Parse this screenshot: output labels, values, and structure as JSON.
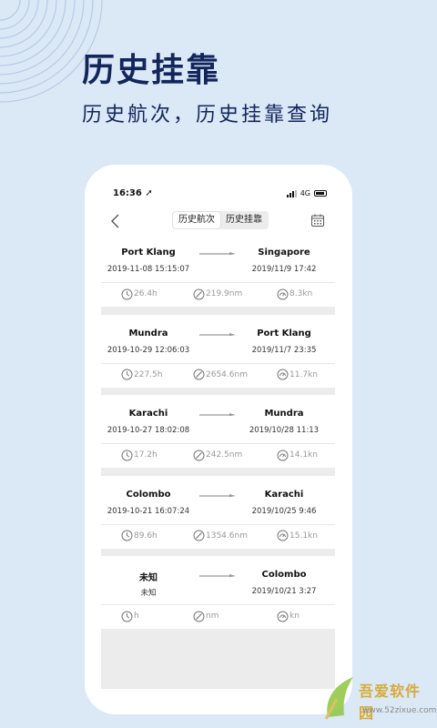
{
  "hero": {
    "title": "历史挂靠",
    "subtitle": "历史航次，历史挂靠查询"
  },
  "status_bar": {
    "time": "16:36 ➚",
    "network": "4G"
  },
  "tabs": [
    {
      "label": "历史航次",
      "active": true
    },
    {
      "label": "历史挂靠",
      "active": false
    }
  ],
  "voyages": [
    {
      "from_port": "Port Klang",
      "from_time": "2019-11-08 15:15:07",
      "to_port": "Singapore",
      "to_time": "2019/11/9 17:42",
      "duration": "26.4h",
      "distance": "219.9nm",
      "speed": "8.3kn"
    },
    {
      "from_port": "Mundra",
      "from_time": "2019-10-29 12:06:03",
      "to_port": "Port Klang",
      "to_time": "2019/11/7 23:35",
      "duration": "227.5h",
      "distance": "2654.6nm",
      "speed": "11.7kn"
    },
    {
      "from_port": "Karachi",
      "from_time": "2019-10-27 18:02:08",
      "to_port": "Mundra",
      "to_time": "2019/10/28 11:13",
      "duration": "17.2h",
      "distance": "242.5nm",
      "speed": "14.1kn"
    },
    {
      "from_port": "Colombo",
      "from_time": "2019-10-21 16:07:24",
      "to_port": "Karachi",
      "to_time": "2019/10/25 9:46",
      "duration": "89.6h",
      "distance": "1354.6nm",
      "speed": "15.1kn"
    },
    {
      "from_port": "未知",
      "from_time": "未知",
      "to_port": "Colombo",
      "to_time": "2019/10/21 3:27",
      "duration": "h",
      "distance": "nm",
      "speed": "kn"
    }
  ],
  "icons": {
    "back": "chevron-left-icon",
    "calendar": "calendar-icon",
    "duration": "clock-icon",
    "distance": "distance-icon",
    "speed": "speedometer-icon"
  },
  "colors": {
    "background": "#dbe8f6",
    "title": "#13265c",
    "stat_text": "#999999"
  },
  "watermark": {
    "text": "吾爱软件园",
    "url": "www.52zixue.com"
  }
}
